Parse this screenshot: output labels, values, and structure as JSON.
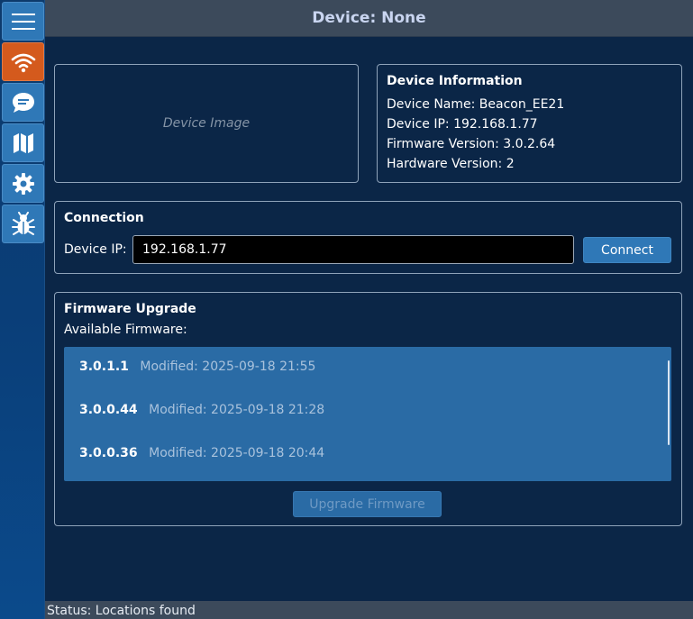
{
  "header": {
    "title": "Device: None"
  },
  "sidebar": {
    "items": [
      {
        "icon": "menu-icon",
        "active": false
      },
      {
        "icon": "wifi-icon",
        "active": true
      },
      {
        "icon": "chat-icon",
        "active": false
      },
      {
        "icon": "map-icon",
        "active": false
      },
      {
        "icon": "gear-icon",
        "active": false
      },
      {
        "icon": "bug-icon",
        "active": false
      }
    ]
  },
  "device_image": {
    "placeholder": "Device Image"
  },
  "device_info": {
    "title": "Device Information",
    "name": "Device Name: Beacon_EE21",
    "ip": "Device IP: 192.168.1.77",
    "firmware": "Firmware Version: 3.0.2.64",
    "hardware": "Hardware Version: 2"
  },
  "connection": {
    "title": "Connection",
    "ip_label": "Device IP:",
    "ip_value": "192.168.1.77",
    "connect_label": "Connect"
  },
  "firmware_upgrade": {
    "title": "Firmware Upgrade",
    "available_label": "Available Firmware:",
    "items": [
      {
        "version": "3.0.1.1",
        "modified": "Modified: 2025-09-18 21:55"
      },
      {
        "version": "3.0.0.44",
        "modified": "Modified: 2025-09-18 21:28"
      },
      {
        "version": "3.0.0.36",
        "modified": "Modified: 2025-09-18 20:44"
      }
    ],
    "upgrade_label": "Upgrade Firmware"
  },
  "status": {
    "text": "Status: Locations found"
  },
  "colors": {
    "sidebar_button": "#2f78b7",
    "sidebar_active": "#d45a1d",
    "background": "#0b2647",
    "header": "#3c4a5b",
    "list_bg": "#2a6ba5"
  }
}
